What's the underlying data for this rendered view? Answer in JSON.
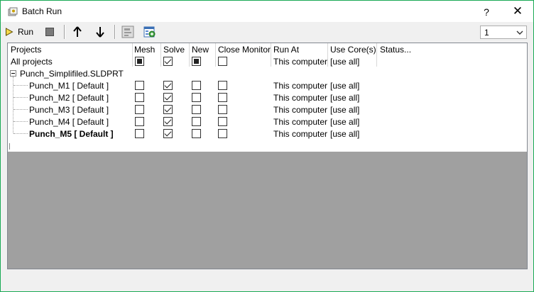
{
  "window": {
    "title": "Batch Run",
    "help_label": "?",
    "close_label": "✕"
  },
  "toolbar": {
    "run_label": "Run",
    "icons": [
      "run-icon",
      "stop-icon",
      "move-up-icon",
      "move-down-icon",
      "add-project-icon",
      "batch-settings-icon"
    ]
  },
  "core_select": {
    "selected": "1"
  },
  "grid": {
    "columns": [
      "Projects",
      "Mesh",
      "Solve",
      "New",
      "Close Monitor",
      "Run At",
      "Use Core(s)",
      "Status..."
    ],
    "all_projects": {
      "label": "All projects",
      "mesh": "indeterminate",
      "solve": "checked",
      "new": "indeterminate",
      "close_monitor": "unchecked",
      "run_at": "This computer",
      "use_cores": "[use all]"
    },
    "group": {
      "label": "Punch_Simplifiled.SLDPRT",
      "expanded": true
    },
    "rows": [
      {
        "label": "Punch_M1 [ Default ]",
        "bold": false,
        "mesh": false,
        "solve": true,
        "new": false,
        "close_monitor": false,
        "run_at": "This computer",
        "use_cores": "[use all]"
      },
      {
        "label": "Punch_M2 [ Default ]",
        "bold": false,
        "mesh": false,
        "solve": true,
        "new": false,
        "close_monitor": false,
        "run_at": "This computer",
        "use_cores": "[use all]"
      },
      {
        "label": "Punch_M3 [ Default ]",
        "bold": false,
        "mesh": false,
        "solve": true,
        "new": false,
        "close_monitor": false,
        "run_at": "This computer",
        "use_cores": "[use all]"
      },
      {
        "label": "Punch_M4 [ Default ]",
        "bold": false,
        "mesh": false,
        "solve": true,
        "new": false,
        "close_monitor": false,
        "run_at": "This computer",
        "use_cores": "[use all]"
      },
      {
        "label": "Punch_M5 [ Default ]",
        "bold": true,
        "mesh": false,
        "solve": true,
        "new": false,
        "close_monitor": false,
        "run_at": "This computer",
        "use_cores": "[use all]"
      }
    ]
  },
  "colors": {
    "window_border": "#1aaa55",
    "run_icon": "#c8a000",
    "background": "#f0f0f0",
    "empty_area": "#a0a0a0"
  }
}
